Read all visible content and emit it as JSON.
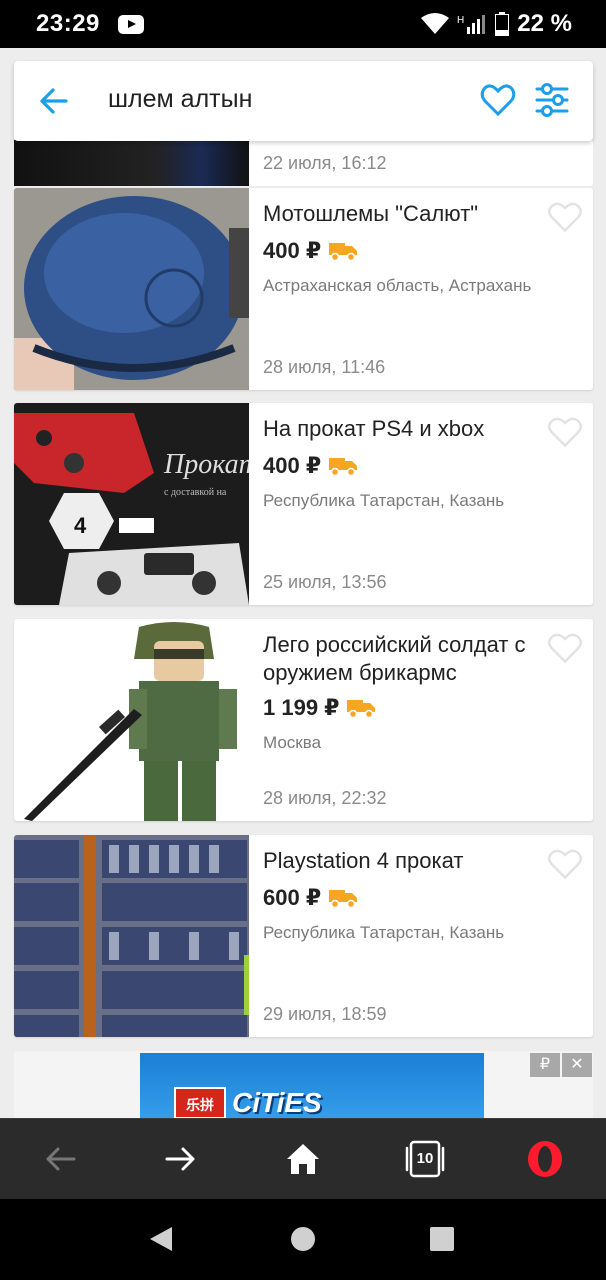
{
  "status_bar": {
    "time": "23:29",
    "battery": "22 %",
    "icons": [
      "youtube-icon",
      "wifi-icon",
      "signal-icon",
      "battery-icon"
    ]
  },
  "search": {
    "query": "шлем алтын",
    "accent_color": "#1a9fe8"
  },
  "listings": {
    "partial_date": "22 июля, 16:12",
    "items": [
      {
        "title": "Мотошлемы \"Салют\"",
        "price": "400 ₽",
        "location": "Астраханская область, Астрахань",
        "date": "28 июля, 11:46"
      },
      {
        "title": "На прокат PS4 и xbox",
        "price": "400 ₽",
        "location": "Республика Татарстан, Казань",
        "date": "25 июля, 13:56"
      },
      {
        "title": "Лего российский солдат с оружием брикармс",
        "price": "1 199 ₽",
        "location": "Москва",
        "date": "28 июля, 22:32"
      },
      {
        "title": "Playstation 4 прокат",
        "price": "600 ₽",
        "location": "Республика Татарстан, Казань",
        "date": "29 июля, 18:59"
      }
    ],
    "delivery_color": "#f5a623"
  },
  "ad": {
    "brand_text": "乐拼",
    "product_text": "CiTiES",
    "ruble_label": "₽",
    "close_label": "✕"
  },
  "browser_nav": {
    "tabs_count": "10",
    "icons": [
      "back-arrow-icon",
      "forward-arrow-icon",
      "home-icon",
      "tabs-icon",
      "opera-icon"
    ]
  },
  "system_nav": {
    "icons": [
      "back-triangle-icon",
      "home-circle-icon",
      "recents-square-icon"
    ]
  }
}
